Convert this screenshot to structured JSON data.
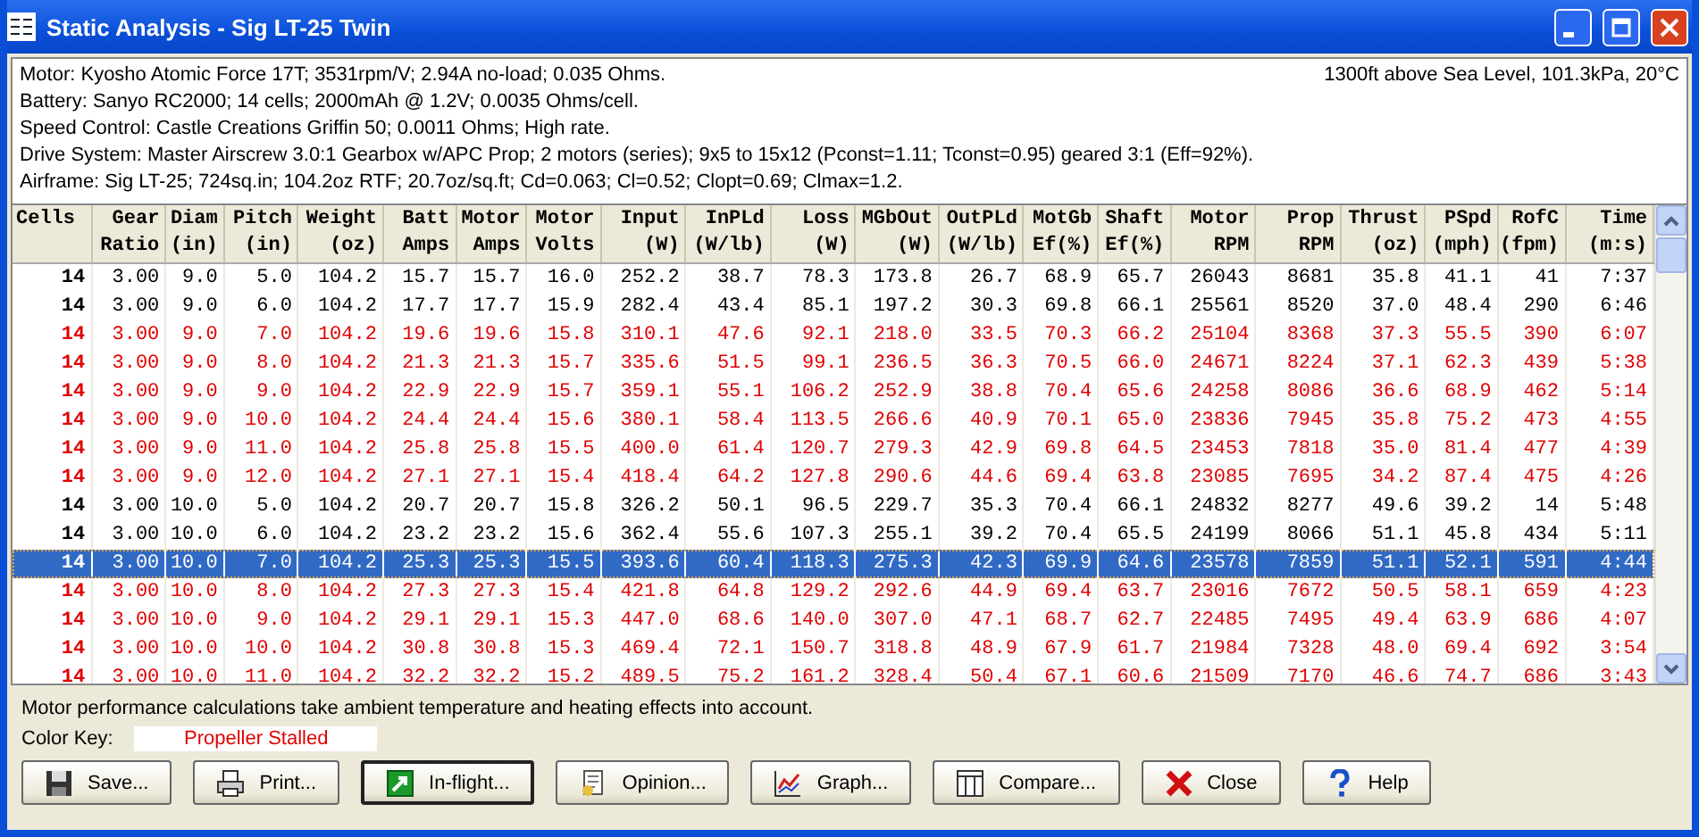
{
  "window": {
    "title": "Static Analysis - Sig LT-25 Twin"
  },
  "info": {
    "lines": [
      "Motor: Kyosho Atomic Force 17T; 3531rpm/V; 2.94A no-load; 0.035 Ohms.",
      "Battery: Sanyo RC2000; 14 cells; 2000mAh @ 1.2V; 0.0035 Ohms/cell.",
      "Speed Control: Castle Creations Griffin 50; 0.0011 Ohms; High rate.",
      "Drive System: Master Airscrew 3.0:1 Gearbox w/APC Prop; 2 motors (series); 9x5 to 15x12 (Pconst=1.11; Tconst=0.95) geared 3:1 (Eff=92%).",
      "Airframe: Sig LT-25; 724sq.in; 104.2oz RTF; 20.7oz/sq.ft; Cd=0.063; Cl=0.52; Clopt=0.69; Clmax=1.2."
    ],
    "conditions": "1300ft above Sea Level, 101.3kPa, 20°C"
  },
  "table": {
    "columns": [
      "Cells",
      "Gear\nRatio",
      "Diam\n(in)",
      "Pitch\n(in)",
      "Weight\n(oz)",
      "Batt\nAmps",
      "Motor\nAmps",
      "Motor\nVolts",
      "Input\n(W)",
      "InPLd\n(W/lb)",
      "Loss\n(W)",
      "MGbOut\n(W)",
      "OutPLd\n(W/lb)",
      "MotGb\nEf(%)",
      "Shaft\nEf(%)",
      "Motor\nRPM",
      "Prop\nRPM",
      "Thrust\n(oz)",
      "PSpd\n(mph)",
      "RofC\n(fpm)",
      "Time\n(m:s)"
    ],
    "rows": [
      {
        "selected": false,
        "stalled": false,
        "cells": [
          "14",
          "3.00",
          "9.0",
          "5.0",
          "104.2",
          "15.7",
          "15.7",
          "16.0",
          "252.2",
          "38.7",
          "78.3",
          "173.8",
          "26.7",
          "68.9",
          "65.7",
          "26043",
          "8681",
          "35.8",
          "41.1",
          "41",
          "7:37"
        ]
      },
      {
        "selected": false,
        "stalled": false,
        "cells": [
          "14",
          "3.00",
          "9.0",
          "6.0",
          "104.2",
          "17.7",
          "17.7",
          "15.9",
          "282.4",
          "43.4",
          "85.1",
          "197.2",
          "30.3",
          "69.8",
          "66.1",
          "25561",
          "8520",
          "37.0",
          "48.4",
          "290",
          "6:46"
        ]
      },
      {
        "selected": false,
        "stalled": true,
        "cells": [
          "14",
          "3.00",
          "9.0",
          "7.0",
          "104.2",
          "19.6",
          "19.6",
          "15.8",
          "310.1",
          "47.6",
          "92.1",
          "218.0",
          "33.5",
          "70.3",
          "66.2",
          "25104",
          "8368",
          "37.3",
          "55.5",
          "390",
          "6:07"
        ]
      },
      {
        "selected": false,
        "stalled": true,
        "cells": [
          "14",
          "3.00",
          "9.0",
          "8.0",
          "104.2",
          "21.3",
          "21.3",
          "15.7",
          "335.6",
          "51.5",
          "99.1",
          "236.5",
          "36.3",
          "70.5",
          "66.0",
          "24671",
          "8224",
          "37.1",
          "62.3",
          "439",
          "5:38"
        ]
      },
      {
        "selected": false,
        "stalled": true,
        "cells": [
          "14",
          "3.00",
          "9.0",
          "9.0",
          "104.2",
          "22.9",
          "22.9",
          "15.7",
          "359.1",
          "55.1",
          "106.2",
          "252.9",
          "38.8",
          "70.4",
          "65.6",
          "24258",
          "8086",
          "36.6",
          "68.9",
          "462",
          "5:14"
        ]
      },
      {
        "selected": false,
        "stalled": true,
        "cells": [
          "14",
          "3.00",
          "9.0",
          "10.0",
          "104.2",
          "24.4",
          "24.4",
          "15.6",
          "380.1",
          "58.4",
          "113.5",
          "266.6",
          "40.9",
          "70.1",
          "65.0",
          "23836",
          "7945",
          "35.8",
          "75.2",
          "473",
          "4:55"
        ]
      },
      {
        "selected": false,
        "stalled": true,
        "cells": [
          "14",
          "3.00",
          "9.0",
          "11.0",
          "104.2",
          "25.8",
          "25.8",
          "15.5",
          "400.0",
          "61.4",
          "120.7",
          "279.3",
          "42.9",
          "69.8",
          "64.5",
          "23453",
          "7818",
          "35.0",
          "81.4",
          "477",
          "4:39"
        ]
      },
      {
        "selected": false,
        "stalled": true,
        "cells": [
          "14",
          "3.00",
          "9.0",
          "12.0",
          "104.2",
          "27.1",
          "27.1",
          "15.4",
          "418.4",
          "64.2",
          "127.8",
          "290.6",
          "44.6",
          "69.4",
          "63.8",
          "23085",
          "7695",
          "34.2",
          "87.4",
          "475",
          "4:26"
        ]
      },
      {
        "selected": false,
        "stalled": false,
        "cells": [
          "14",
          "3.00",
          "10.0",
          "5.0",
          "104.2",
          "20.7",
          "20.7",
          "15.8",
          "326.2",
          "50.1",
          "96.5",
          "229.7",
          "35.3",
          "70.4",
          "66.1",
          "24832",
          "8277",
          "49.6",
          "39.2",
          "14",
          "5:48"
        ]
      },
      {
        "selected": false,
        "stalled": false,
        "cells": [
          "14",
          "3.00",
          "10.0",
          "6.0",
          "104.2",
          "23.2",
          "23.2",
          "15.6",
          "362.4",
          "55.6",
          "107.3",
          "255.1",
          "39.2",
          "70.4",
          "65.5",
          "24199",
          "8066",
          "51.1",
          "45.8",
          "434",
          "5:11"
        ]
      },
      {
        "selected": true,
        "stalled": false,
        "cells": [
          "14",
          "3.00",
          "10.0",
          "7.0",
          "104.2",
          "25.3",
          "25.3",
          "15.5",
          "393.6",
          "60.4",
          "118.3",
          "275.3",
          "42.3",
          "69.9",
          "64.6",
          "23578",
          "7859",
          "51.1",
          "52.1",
          "591",
          "4:44"
        ]
      },
      {
        "selected": false,
        "stalled": true,
        "cells": [
          "14",
          "3.00",
          "10.0",
          "8.0",
          "104.2",
          "27.3",
          "27.3",
          "15.4",
          "421.8",
          "64.8",
          "129.2",
          "292.6",
          "44.9",
          "69.4",
          "63.7",
          "23016",
          "7672",
          "50.5",
          "58.1",
          "659",
          "4:23"
        ]
      },
      {
        "selected": false,
        "stalled": true,
        "cells": [
          "14",
          "3.00",
          "10.0",
          "9.0",
          "104.2",
          "29.1",
          "29.1",
          "15.3",
          "447.0",
          "68.6",
          "140.0",
          "307.0",
          "47.1",
          "68.7",
          "62.7",
          "22485",
          "7495",
          "49.4",
          "63.9",
          "686",
          "4:07"
        ]
      },
      {
        "selected": false,
        "stalled": true,
        "cells": [
          "14",
          "3.00",
          "10.0",
          "10.0",
          "104.2",
          "30.8",
          "30.8",
          "15.3",
          "469.4",
          "72.1",
          "150.7",
          "318.8",
          "48.9",
          "67.9",
          "61.7",
          "21984",
          "7328",
          "48.0",
          "69.4",
          "692",
          "3:54"
        ]
      },
      {
        "selected": false,
        "stalled": true,
        "cells": [
          "14",
          "3.00",
          "10.0",
          "11.0",
          "104.2",
          "32.2",
          "32.2",
          "15.2",
          "489.5",
          "75.2",
          "161.2",
          "328.4",
          "50.4",
          "67.1",
          "60.6",
          "21509",
          "7170",
          "46.6",
          "74.7",
          "686",
          "3:43"
        ]
      }
    ]
  },
  "note": "Motor performance calculations take ambient temperature and heating effects into account.",
  "color_key": {
    "label": "Color Key:",
    "entry": "Propeller Stalled",
    "color": "#e00000"
  },
  "buttons": [
    {
      "kind": "save",
      "label": "Save..."
    },
    {
      "kind": "print",
      "label": "Print..."
    },
    {
      "kind": "inflight",
      "label": "In-flight..."
    },
    {
      "kind": "opinion",
      "label": "Opinion..."
    },
    {
      "kind": "graph",
      "label": "Graph..."
    },
    {
      "kind": "compare",
      "label": "Compare..."
    },
    {
      "kind": "close",
      "label": "Close"
    },
    {
      "kind": "help",
      "label": "Help"
    }
  ]
}
